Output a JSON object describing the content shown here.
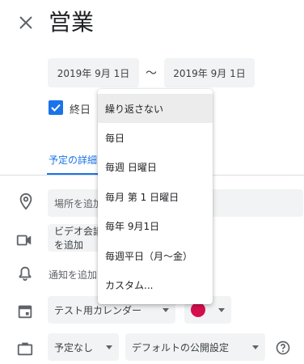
{
  "event": {
    "title": "営業",
    "start_date": "2019年 9月 1日",
    "end_date": "2019年 9月 1日",
    "separator": "〜"
  },
  "allday": {
    "label": "終日",
    "checked": true
  },
  "tabs": {
    "details": "予定の詳細"
  },
  "location": {
    "placeholder": "場所を追加"
  },
  "video": {
    "label": "ビデオ会議を追加"
  },
  "notification": {
    "label": "通知を追加"
  },
  "calendar": {
    "name": "テスト用カレンダー",
    "color": "#d50f4e"
  },
  "availability": {
    "value": "予定なし"
  },
  "visibility": {
    "value": "デフォルトの公開設定"
  },
  "recurrence_menu": {
    "items": [
      "繰り返さない",
      "毎日",
      "毎週 日曜日",
      "毎月 第 1 日曜日",
      "毎年 9月1日",
      "毎週平日（月〜金）",
      "カスタム..."
    ],
    "selected_index": 0
  },
  "icons": {
    "close": "close-icon",
    "location": "location-pin-icon",
    "video": "video-camera-icon",
    "notification": "bell-icon",
    "calendar": "calendar-icon",
    "availability": "briefcase-icon",
    "help": "help-icon"
  },
  "colors": {
    "accent": "#1a73e8",
    "field_bg": "#f1f3f4"
  }
}
